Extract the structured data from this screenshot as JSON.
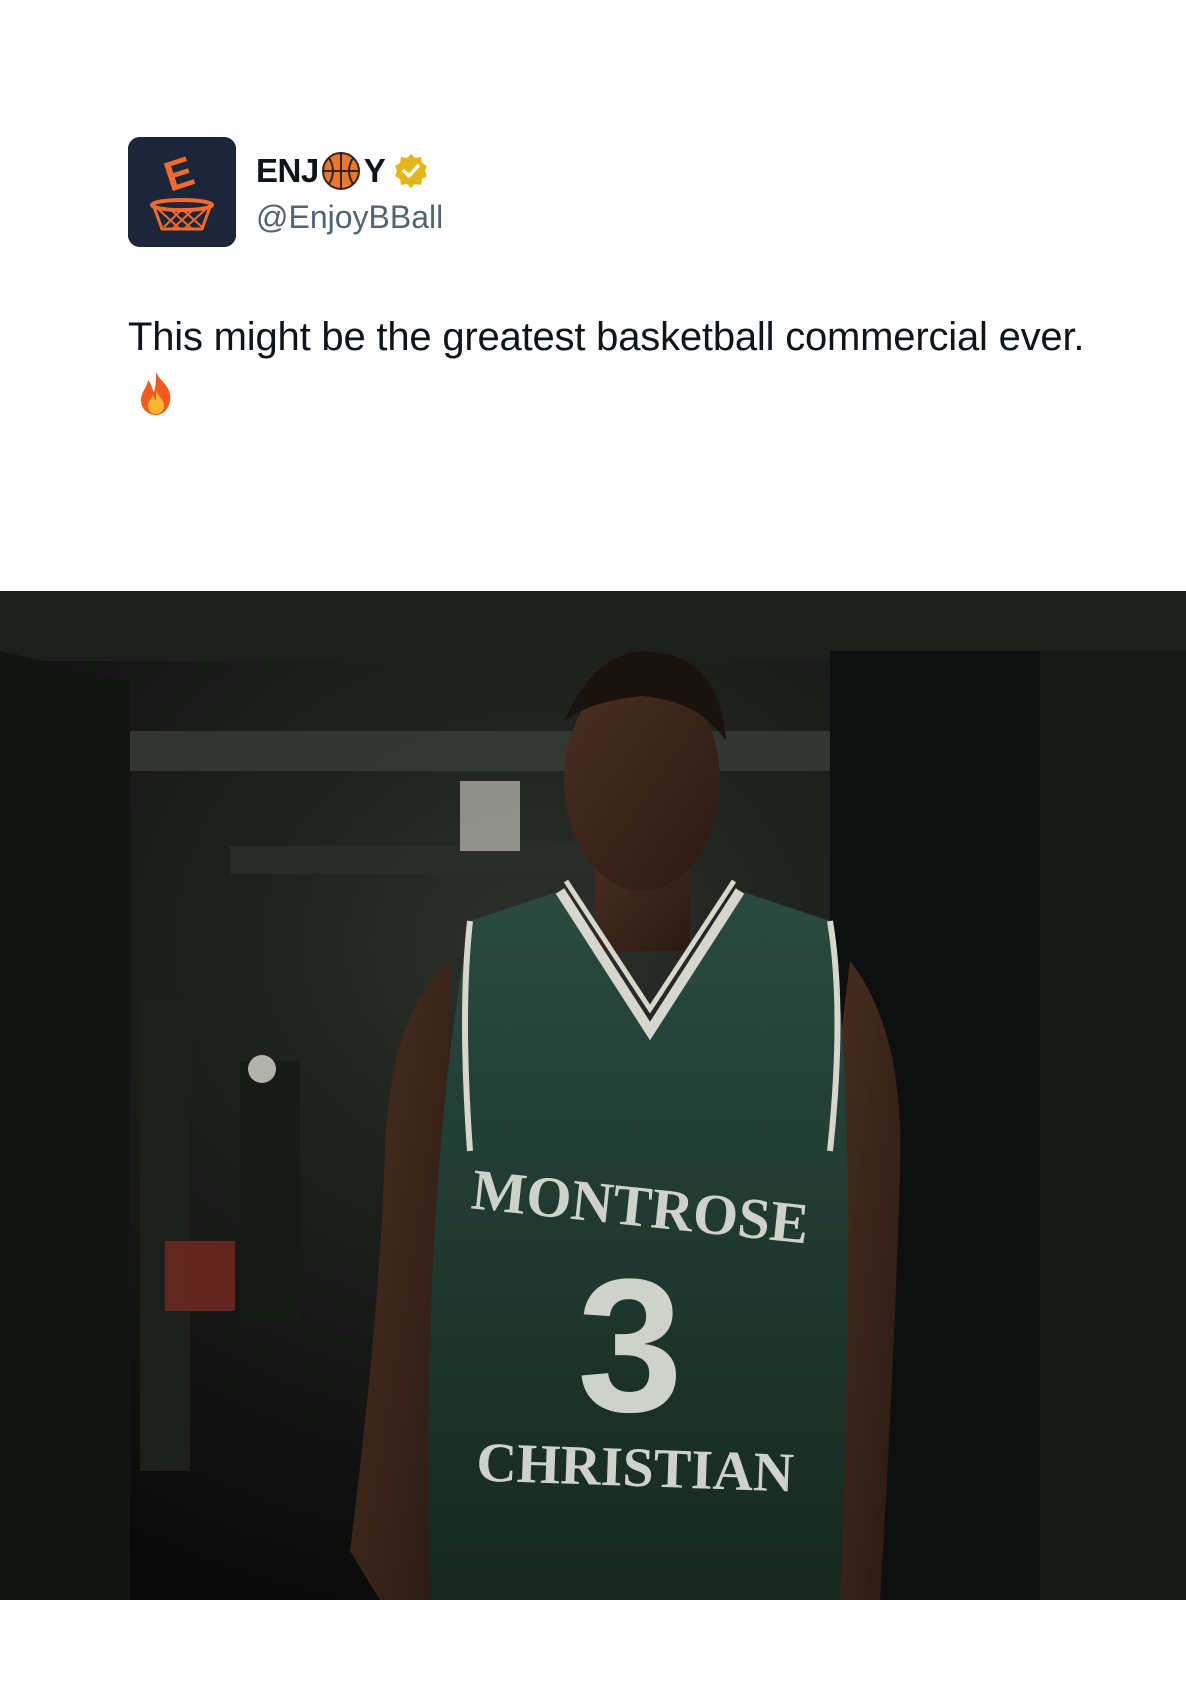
{
  "tweet": {
    "author": {
      "name_before": "ENJ",
      "name_emoji": "basketball-icon",
      "name_after": "Y",
      "handle": "@EnjoyBBall",
      "verified": true,
      "verified_color": "#e2b719",
      "avatar_letter": "E",
      "avatar_bg": "#1c2638",
      "avatar_accent": "#f26a2e"
    },
    "text": "This might be the greatest basketball commercial ever.",
    "text_emoji": "fire-icon"
  },
  "media": {
    "type": "video-frame",
    "jersey_top": "MONTROSE",
    "jersey_number": "3",
    "jersey_bottom": "CHRISTIAN",
    "jersey_color": "#1f3b33"
  }
}
